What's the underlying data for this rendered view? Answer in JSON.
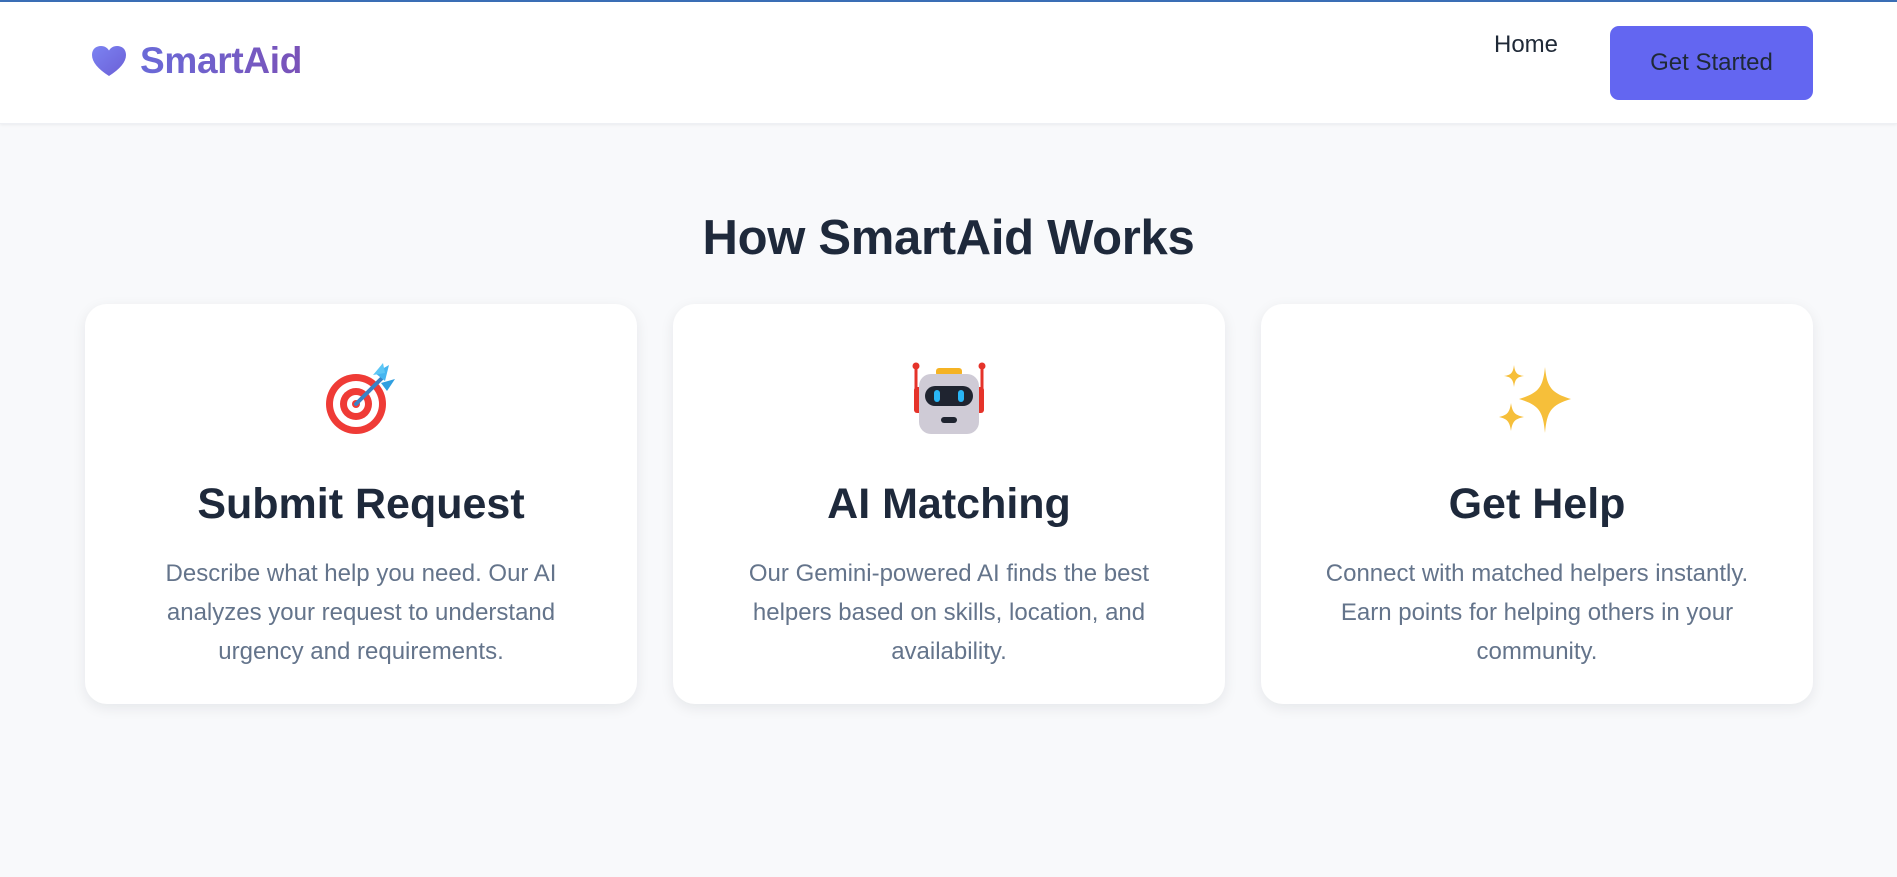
{
  "header": {
    "brand": "SmartAid",
    "nav": {
      "home_label": "Home",
      "cta_label": "Get Started"
    }
  },
  "section": {
    "title": "How SmartAid Works",
    "cards": [
      {
        "icon": "target-dart-icon",
        "title": "Submit Request",
        "description": "Describe what help you need. Our AI analyzes your request to understand urgency and requirements."
      },
      {
        "icon": "robot-icon",
        "title": "AI Matching",
        "description": "Our Gemini-powered AI finds the best helpers based on skills, location, and availability."
      },
      {
        "icon": "sparkles-icon",
        "title": "Get Help",
        "description": "Connect with matched helpers instantly. Earn points for helping others in your community."
      }
    ]
  },
  "colors": {
    "accent": "#6366f1",
    "brand_gradient_start": "#6a6ad8",
    "brand_gradient_end": "#7a52b8",
    "page_background": "#f8f9fb",
    "heading": "#1e293b",
    "body_text": "#64748b"
  }
}
